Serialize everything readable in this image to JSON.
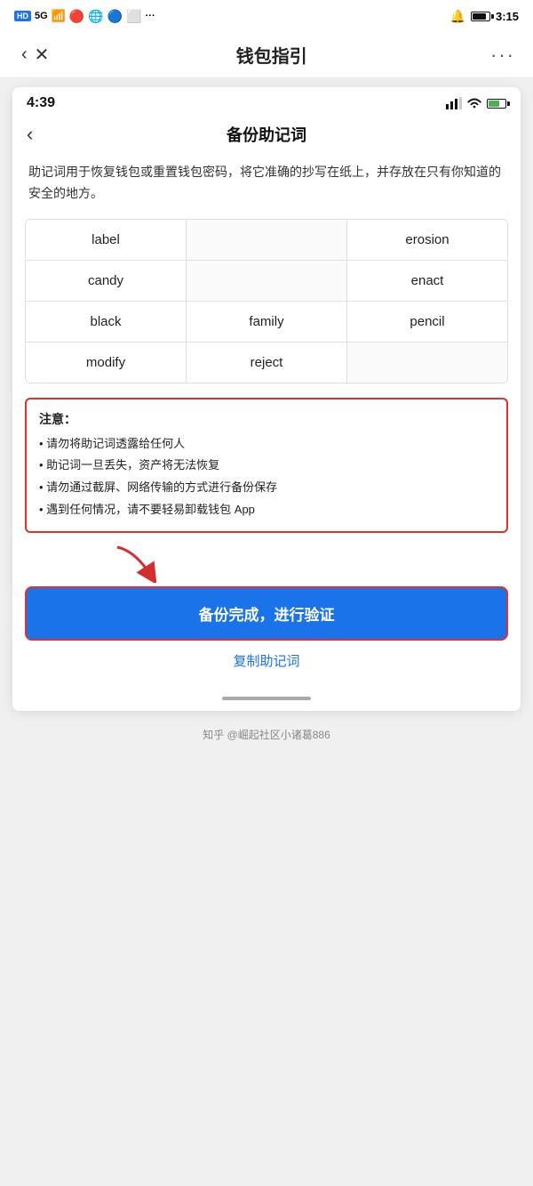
{
  "outerStatusBar": {
    "time": "3:15",
    "hd": "HD",
    "signal": "5G"
  },
  "appNavBar": {
    "backLabel": "‹",
    "closeLabel": "✕",
    "title": "钱包指引",
    "moreLabel": "···"
  },
  "innerStatusBar": {
    "time": "4:39"
  },
  "innerNavBar": {
    "backLabel": "‹",
    "title": "备份助记词"
  },
  "description": "助记词用于恢复钱包或重置钱包密码，将它准确的抄写在纸上，并存放在只有你知道的安全的地方。",
  "mnemonicWords": [
    [
      "label",
      "",
      "erosion"
    ],
    [
      "candy",
      "",
      "enact"
    ],
    [
      "black",
      "family",
      "pencil"
    ],
    [
      "modify",
      "reject",
      ""
    ]
  ],
  "warning": {
    "title": "注意：",
    "items": [
      "• 请勿将助记词透露给任何人",
      "• 助记词一旦丢失，资产将无法恢复",
      "• 请勿通过截屏、网络传输的方式进行备份保存",
      "• 遇到任何情况，请不要轻易卸载钱包 App"
    ]
  },
  "backupButton": {
    "label": "备份完成，进行验证"
  },
  "copyLink": {
    "label": "复制助记词"
  },
  "watermark": {
    "text": "知乎 @崛起社区小诸葛886"
  }
}
